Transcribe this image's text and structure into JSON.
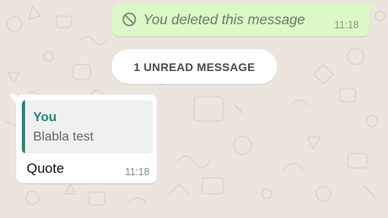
{
  "chat": {
    "background_color": "#ece5dd",
    "outgoing": {
      "icon": "blocked-icon",
      "text": "You deleted this message",
      "time": "11:18",
      "bubble_color": "#dcf8c6"
    },
    "divider": {
      "label": "1 UNREAD MESSAGE"
    },
    "incoming": {
      "quote": {
        "author": "You",
        "text": "Blabla test",
        "accent_color": "#1f8a7a"
      },
      "text": "Quote",
      "time": "11:18",
      "bubble_color": "#ffffff"
    }
  }
}
